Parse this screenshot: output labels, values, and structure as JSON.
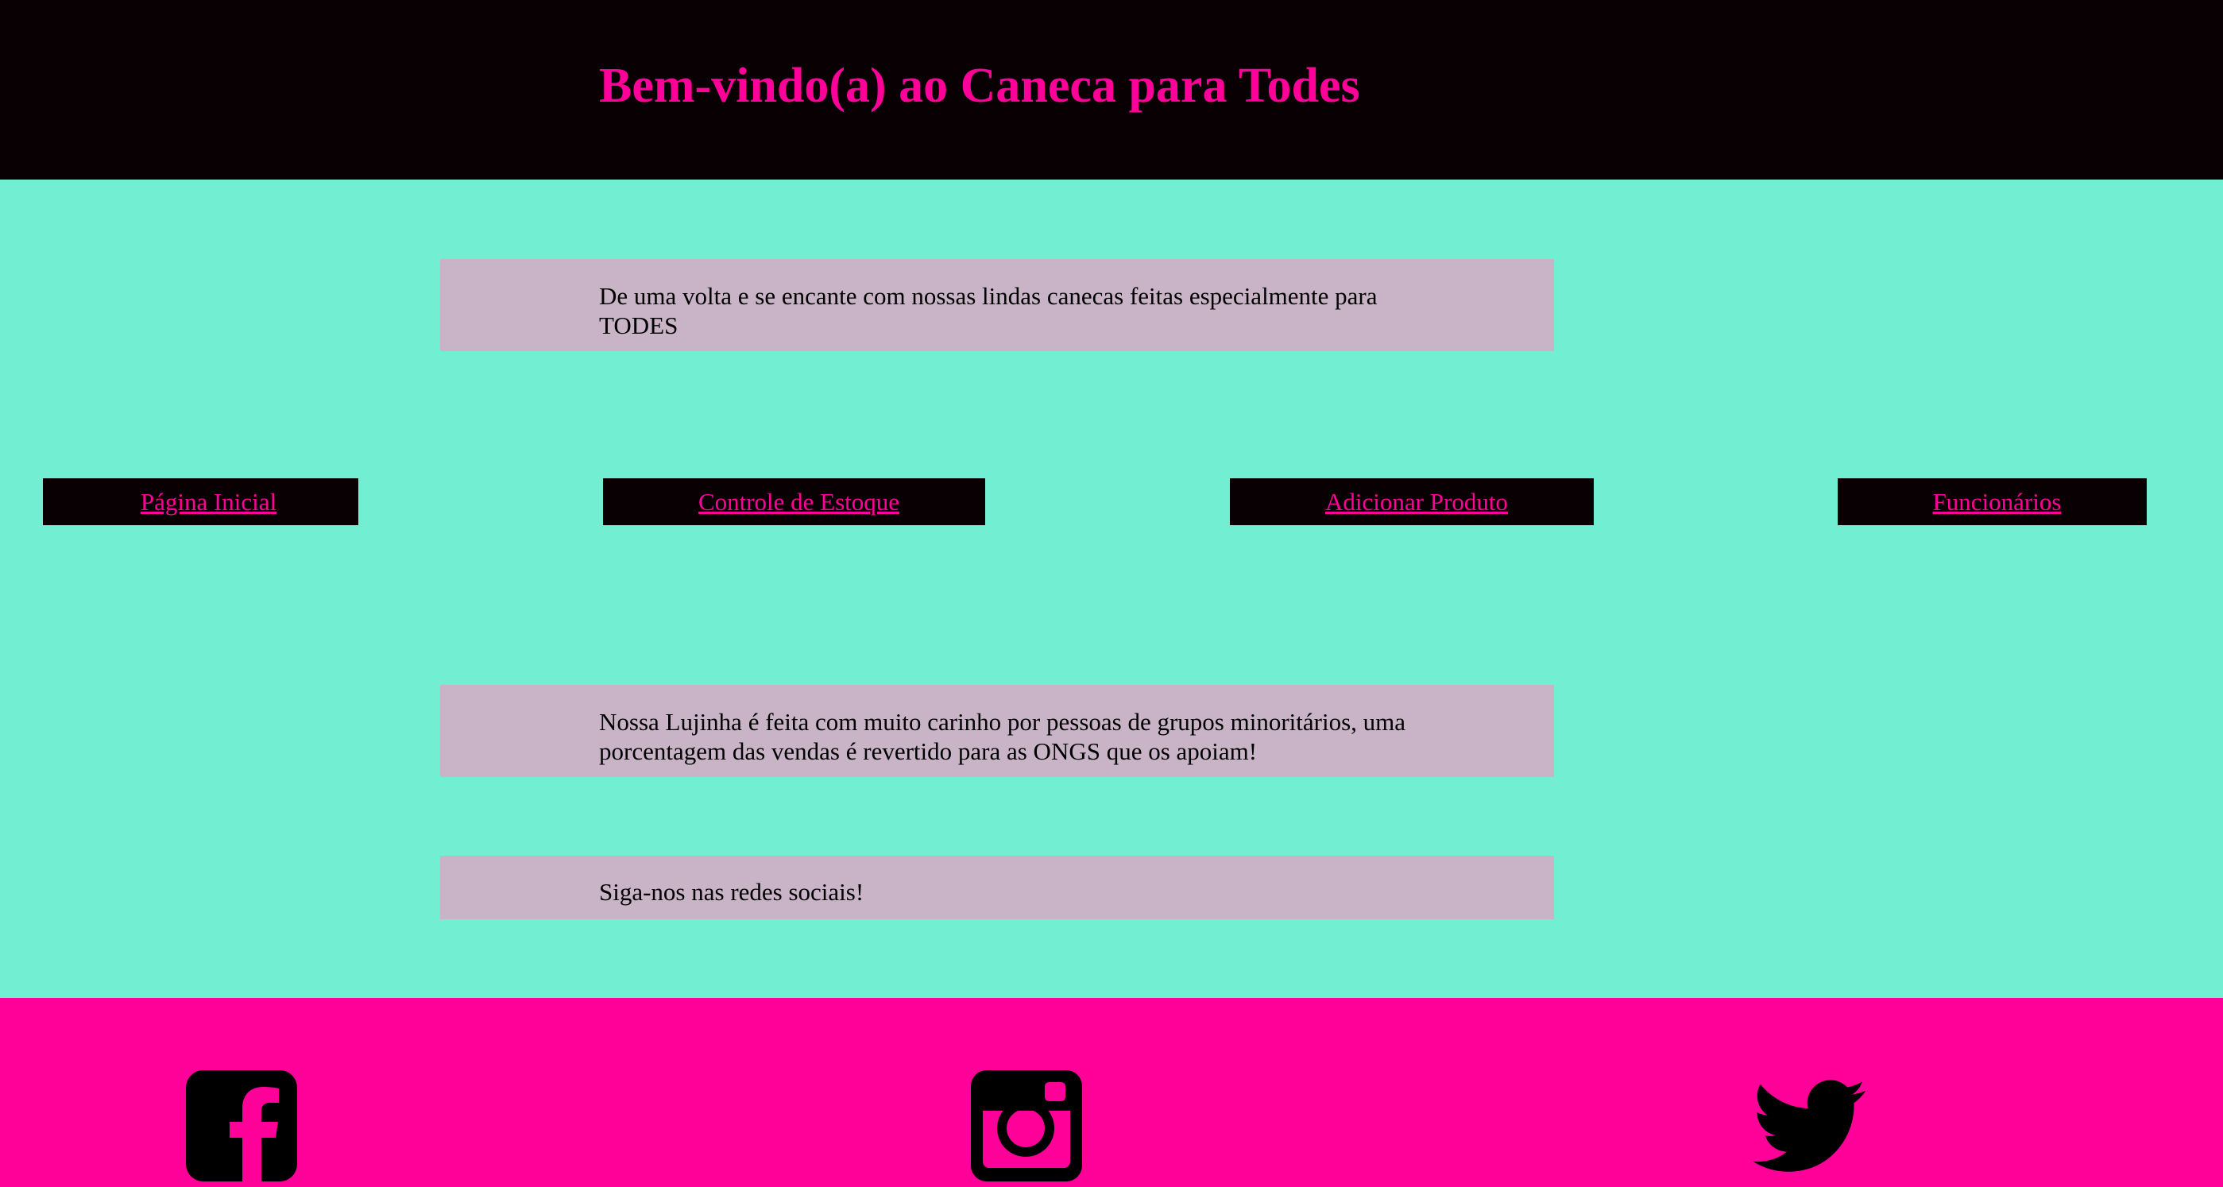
{
  "header": {
    "title": "Bem-vindo(a) ao Caneca para Todes"
  },
  "panels": {
    "intro": {
      "text": "De uma volta e se encante com nossas lindas canecas feitas especialmente para TODES"
    },
    "about": {
      "text": "Nossa Lujinha é feita com muito carinho por pessoas de grupos minoritários, uma porcentagem das vendas é revertido para as ONGS que os apoiam!"
    },
    "social": {
      "text": "Siga-nos nas redes sociais!"
    }
  },
  "nav": {
    "items": [
      {
        "label": "Página Inicial"
      },
      {
        "label": "Controle de Estoque"
      },
      {
        "label": "Adicionar Produto"
      },
      {
        "label": "Funcionários"
      }
    ]
  },
  "footer": {
    "icons": [
      "facebook-icon",
      "instagram-icon",
      "twitter-icon"
    ]
  },
  "colors": {
    "background": "#72eed3",
    "header_bg": "#080003",
    "accent": "#ff0199",
    "panel_bg": "#c8b4c6"
  }
}
